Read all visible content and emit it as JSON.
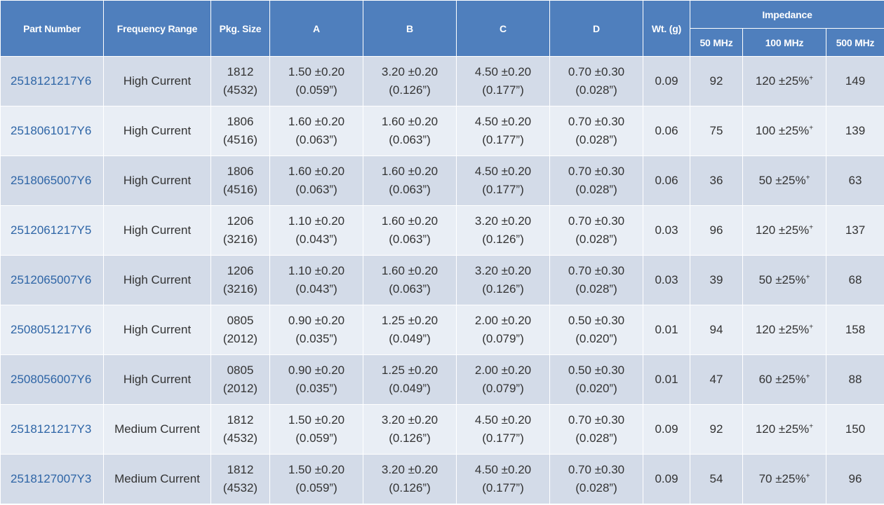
{
  "headers": {
    "part_number": "Part Number",
    "frequency_range": "Frequency Range",
    "pkg_size": "Pkg. Size",
    "a": "A",
    "b": "B",
    "c": "C",
    "d": "D",
    "weight": "Wt. (g)",
    "impedance": "Impedance",
    "imp_50": "50 MHz",
    "imp_100": "100 MHz",
    "imp_500": "500 MHz"
  },
  "rows": [
    {
      "part": "2518121217Y6",
      "freq": "High Current",
      "pkg": [
        "1812",
        "(4532)"
      ],
      "a": [
        "1.50 ±0.20",
        "(0.059”)"
      ],
      "b": [
        "3.20 ±0.20",
        "(0.126”)"
      ],
      "c": [
        "4.50 ±0.20",
        "(0.177”)"
      ],
      "d": [
        "0.70 ±0.30",
        "(0.028”)"
      ],
      "wt": "0.09",
      "z50": "92",
      "z100": "120 ±25%",
      "z100_sup": "+",
      "z500": "149"
    },
    {
      "part": "2518061017Y6",
      "freq": "High Current",
      "pkg": [
        "1806",
        "(4516)"
      ],
      "a": [
        "1.60 ±0.20",
        "(0.063”)"
      ],
      "b": [
        "1.60 ±0.20",
        "(0.063”)"
      ],
      "c": [
        "4.50 ±0.20",
        "(0.177”)"
      ],
      "d": [
        "0.70 ±0.30",
        "(0.028”)"
      ],
      "wt": "0.06",
      "z50": "75",
      "z100": "100 ±25%",
      "z100_sup": "+",
      "z500": "139"
    },
    {
      "part": "2518065007Y6",
      "freq": "High Current",
      "pkg": [
        "1806",
        "(4516)"
      ],
      "a": [
        "1.60 ±0.20",
        "(0.063”)"
      ],
      "b": [
        "1.60 ±0.20",
        "(0.063”)"
      ],
      "c": [
        "4.50 ±0.20",
        "(0.177”)"
      ],
      "d": [
        "0.70 ±0.30",
        "(0.028”)"
      ],
      "wt": "0.06",
      "z50": "36",
      "z100": "50 ±25%",
      "z100_sup": "+",
      "z500": "63"
    },
    {
      "part": "2512061217Y5",
      "freq": "High Current",
      "pkg": [
        "1206",
        "(3216)"
      ],
      "a": [
        "1.10 ±0.20",
        "(0.043”)"
      ],
      "b": [
        "1.60 ±0.20",
        "(0.063”)"
      ],
      "c": [
        "3.20 ±0.20",
        "(0.126”)"
      ],
      "d": [
        "0.70 ±0.30",
        "(0.028”)"
      ],
      "wt": "0.03",
      "z50": "96",
      "z100": "120 ±25%",
      "z100_sup": "+",
      "z500": "137"
    },
    {
      "part": "2512065007Y6",
      "freq": "High Current",
      "pkg": [
        "1206",
        "(3216)"
      ],
      "a": [
        "1.10 ±0.20",
        "(0.043”)"
      ],
      "b": [
        "1.60 ±0.20",
        "(0.063”)"
      ],
      "c": [
        "3.20 ±0.20",
        "(0.126”)"
      ],
      "d": [
        "0.70 ±0.30",
        "(0.028”)"
      ],
      "wt": "0.03",
      "z50": "39",
      "z100": "50 ±25%",
      "z100_sup": "+",
      "z500": "68"
    },
    {
      "part": "2508051217Y6",
      "freq": "High Current",
      "pkg": [
        "0805",
        "(2012)"
      ],
      "a": [
        "0.90 ±0.20",
        "(0.035”)"
      ],
      "b": [
        "1.25 ±0.20",
        "(0.049”)"
      ],
      "c": [
        "2.00 ±0.20",
        "(0.079”)"
      ],
      "d": [
        "0.50 ±0.30",
        "(0.020”)"
      ],
      "wt": "0.01",
      "z50": "94",
      "z100": "120 ±25%",
      "z100_sup": "+",
      "z500": "158"
    },
    {
      "part": "2508056007Y6",
      "freq": "High Current",
      "pkg": [
        "0805",
        "(2012)"
      ],
      "a": [
        "0.90 ±0.20",
        "(0.035”)"
      ],
      "b": [
        "1.25 ±0.20",
        "(0.049”)"
      ],
      "c": [
        "2.00 ±0.20",
        "(0.079”)"
      ],
      "d": [
        "0.50 ±0.30",
        "(0.020”)"
      ],
      "wt": "0.01",
      "z50": "47",
      "z100": "60 ±25%",
      "z100_sup": "+",
      "z500": "88"
    },
    {
      "part": "2518121217Y3",
      "freq": "Medium Current",
      "pkg": [
        "1812",
        "(4532)"
      ],
      "a": [
        "1.50 ±0.20",
        "(0.059”)"
      ],
      "b": [
        "3.20 ±0.20",
        "(0.126”)"
      ],
      "c": [
        "4.50 ±0.20",
        "(0.177”)"
      ],
      "d": [
        "0.70 ±0.30",
        "(0.028”)"
      ],
      "wt": "0.09",
      "z50": "92",
      "z100": "120 ±25%",
      "z100_sup": "+",
      "z500": "150"
    },
    {
      "part": "2518127007Y3",
      "freq": "Medium Current",
      "pkg": [
        "1812",
        "(4532)"
      ],
      "a": [
        "1.50 ±0.20",
        "(0.059”)"
      ],
      "b": [
        "3.20 ±0.20",
        "(0.126”)"
      ],
      "c": [
        "4.50 ±0.20",
        "(0.177”)"
      ],
      "d": [
        "0.70 ±0.30",
        "(0.028”)"
      ],
      "wt": "0.09",
      "z50": "54",
      "z100": "70 ±25%",
      "z100_sup": "+",
      "z500": "96"
    }
  ]
}
